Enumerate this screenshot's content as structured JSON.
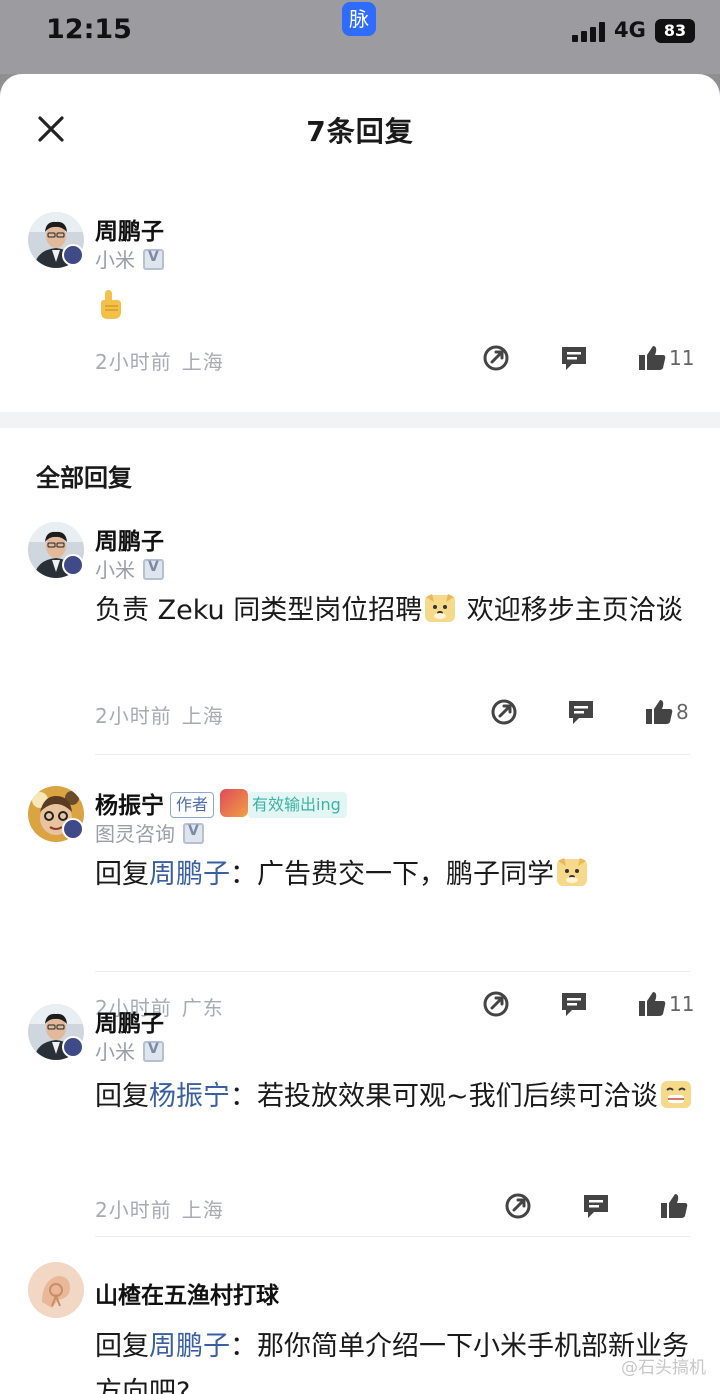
{
  "status": {
    "time": "12:15",
    "app_badge": "脉",
    "network": "4G",
    "battery": "83"
  },
  "sheet": {
    "title": "7条回复",
    "section_title": "全部回复"
  },
  "top_comment": {
    "name": "周鹏子",
    "company": "小米",
    "time": "2小时前",
    "location": "上海",
    "likes": "11"
  },
  "replies": [
    {
      "name": "周鹏子",
      "company": "小米",
      "text_a": "负责 Zeku 同类型岗位招聘",
      "text_b": " 欢迎移步主页洽谈",
      "time": "2小时前",
      "location": "上海",
      "likes": "8"
    },
    {
      "name": "杨振宁",
      "author_tag": "作者",
      "achievement": "有效输出ing",
      "company": "图灵咨询",
      "reply_prefix": "回复",
      "mention": "周鹏子",
      "text": "：广告费交一下，鹏子同学",
      "time": "2小时前",
      "location": "广东",
      "likes": "11"
    },
    {
      "name": "周鹏子",
      "company": "小米",
      "reply_prefix": "回复",
      "mention": "杨振宁",
      "text": "：若投放效果可观~我们后续可洽谈",
      "time": "2小时前",
      "location": "上海"
    },
    {
      "name": "山楂在五渔村打球",
      "reply_prefix": "回复",
      "mention": "周鹏子",
      "text": "：那你简单介绍一下小米手机部新业务方向吧?"
    }
  ],
  "watermark": "@石头搞机",
  "colors": {
    "accent": "#2f6bff",
    "mention": "#3a5fa0",
    "meta": "#a7abb2"
  }
}
